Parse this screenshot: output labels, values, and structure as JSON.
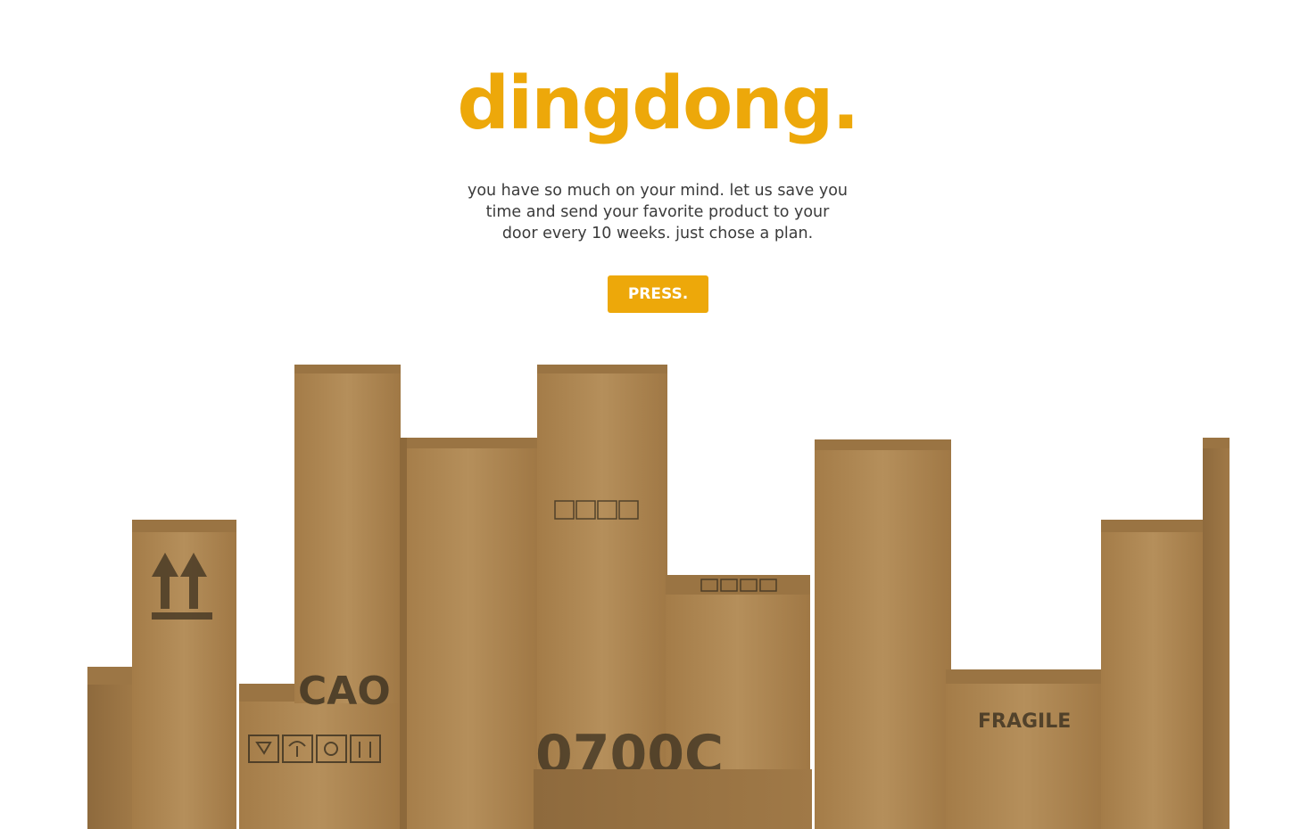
{
  "hero": {
    "brand": "dingdong.",
    "tagline_lines": [
      "you have so much on your mind. let us save you",
      "time and send your favorite product to your",
      "door every 10 weeks. just chose a plan."
    ],
    "cta_label": "PRESS."
  },
  "illustration": {
    "fragile_label": "FRAGILE",
    "stencil_top": "CAO",
    "stencil_mid": "0700C",
    "brand_color": "#EDA80A",
    "cardboard_color": "#B08A55"
  }
}
